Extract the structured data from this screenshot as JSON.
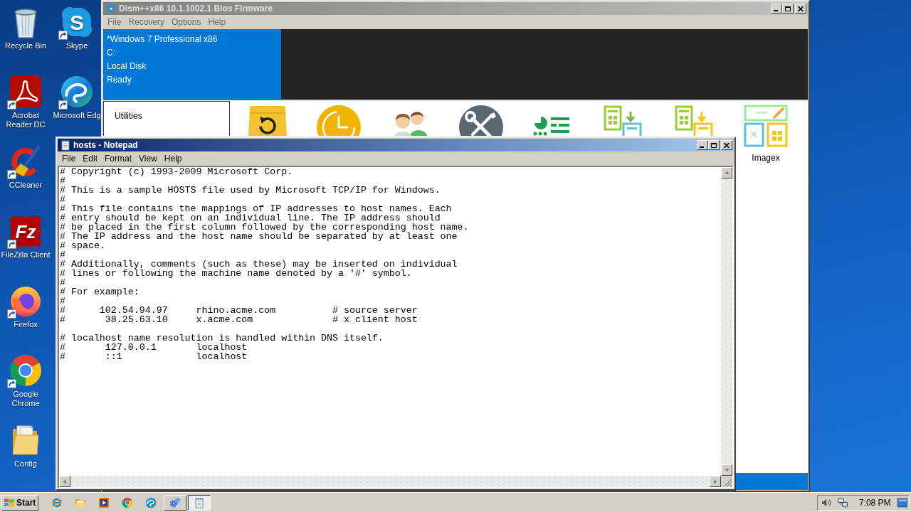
{
  "desktop_icons": [
    {
      "label": "Recycle Bin",
      "kind": "bin",
      "shortcut": false
    },
    {
      "label": "Acrobat Reader DC",
      "kind": "pdf",
      "shortcut": true
    },
    {
      "label": "CCleaner",
      "kind": "broom",
      "shortcut": true
    },
    {
      "label": "FileZilla Client",
      "kind": "ftp",
      "shortcut": true,
      "logo_text": "Fz"
    },
    {
      "label": "Firefox",
      "kind": "fox",
      "shortcut": true
    },
    {
      "label": "Google Chrome",
      "kind": "chrome",
      "shortcut": true
    },
    {
      "label": "Config",
      "kind": "folder",
      "shortcut": false
    },
    {
      "label": "Skype",
      "kind": "chat",
      "shortcut": true,
      "logo_text": "S"
    },
    {
      "label": "Microsoft Edg",
      "kind": "wave",
      "shortcut": true
    }
  ],
  "dism_window": {
    "title": "Dism++x86 10.1.1002.1 Bios Firmware",
    "active": false,
    "menu": [
      "File",
      "Recovery",
      "Options",
      "Help"
    ],
    "info_lines": [
      "*Windows 7 Professional x86",
      "C:",
      "Local Disk",
      "Ready"
    ],
    "section": "Utilities",
    "tools": [
      {
        "kind": "restore"
      },
      {
        "kind": "clock"
      },
      {
        "kind": "users"
      },
      {
        "kind": "repair"
      },
      {
        "kind": "chart"
      },
      {
        "kind": "esd-iso"
      },
      {
        "kind": "esd-wim"
      },
      {
        "kind": "imagex",
        "label": "Imagex"
      }
    ]
  },
  "notepad_window": {
    "title": "hosts - Notepad",
    "active": true,
    "menu": [
      "File",
      "Edit",
      "Format",
      "View",
      "Help"
    ],
    "text_blocks": [
      [
        "# Copyright (c) 1993-2009 Microsoft Corp.",
        "#",
        "# This is a sample HOSTS file used by Microsoft TCP/IP for Windows.",
        "#",
        "# This file contains the mappings of IP addresses to host names. Each",
        "# entry should be kept on an individual line. The IP address should",
        "# be placed in the first column followed by the corresponding host name.",
        "# The IP address and the host name should be separated by at least one",
        "# space.",
        "#",
        "# Additionally, comments (such as these) may be inserted on individual",
        "# lines or following the machine name denoted by a '#' symbol.",
        "#",
        "# For example:",
        "#",
        "#      102.54.94.97     rhino.acme.com          # source server",
        "#       38.25.63.10     x.acme.com              # x client host"
      ],
      [
        "# localhost name resolution is handled within DNS itself.",
        "#       127.0.0.1       localhost",
        "#       ::1             localhost"
      ]
    ]
  },
  "taskbar": {
    "start_label": "Start",
    "quick_launch": [
      {
        "kind": "ie"
      },
      {
        "kind": "explorer"
      },
      {
        "kind": "media"
      },
      {
        "kind": "chrome"
      },
      {
        "kind": "edge"
      }
    ],
    "tasks": [
      {
        "kind": "dism",
        "selected": false
      },
      {
        "kind": "notepad",
        "selected": true
      }
    ],
    "clock": "7:08 PM"
  }
}
